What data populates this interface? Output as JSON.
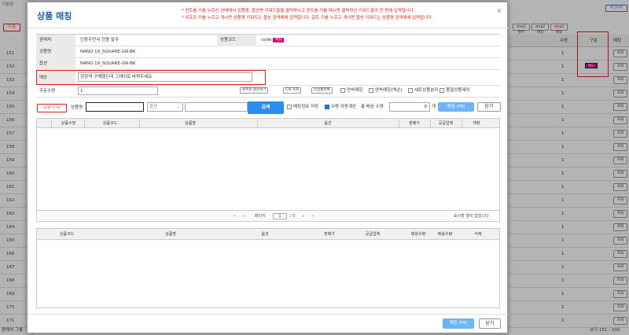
{
  "background": {
    "left_rows": [
      "151",
      "152",
      "153",
      "154",
      "155",
      "156",
      "157",
      "158",
      "159",
      "160",
      "161",
      "162",
      "163",
      "164",
      "165",
      "166",
      "167",
      "168",
      "169",
      "170",
      "171"
    ],
    "right_top_buttons": [
      "step1 발주",
      "step2 메일",
      "step3 메일"
    ],
    "right_logout": "로그아웃",
    "right_headers": [
      "수량",
      "구분",
      "매칭"
    ],
    "right_qty": "1",
    "right_gubun_badge": "메모",
    "right_match_btn": "조회",
    "left_top_label": "기본정",
    "left_del_btn": "다 을",
    "bottom_left": "판매처 그룹",
    "bottom_right": "보기 151 - 200"
  },
  "modal": {
    "title": "상품 매칭",
    "notice": [
      "* 컨트롤 키를 누르신 상태에서 상품명, 옵션명 키워드들을 클릭하시고 컨트롤 키를 떼시면 클릭하신 키워드들이 한 번에 입력됩니다.",
      "* 쉬프트 키를 누르고 게시면 상품명 키워드는 옵션 검색에에 입력됩니다. 알트 키를 누르고 게시면 옵션 키워드는 상품명 검색에에 입력됩니다."
    ],
    "close": "✕",
    "info": {
      "seller_label": "판매처",
      "seller_value": "인동우먼서 전용 발주",
      "code_label": "상품코드",
      "code_value": "code",
      "code_badge": "매칭",
      "product_label": "상품명",
      "product_value": "NANO 19_SQUARE-GN-BK",
      "option_label": "옵션",
      "option_value": "NANO 19_SQUARE-GN-BK",
      "memo_label": "메모",
      "memo_value": "검정색 구매했는데 그레이로 바꿔주세요",
      "order_qty_label": "주문수량",
      "order_qty_value": "1"
    },
    "tools": {
      "btn1": "원주문 옵션보기",
      "btn2": "C/S 조회",
      "btn3": "신상품등록",
      "chk1": "연속매칭",
      "chk2": "연속매칭(엑손)",
      "chk3": "세트상품분리",
      "chk4": "품절상품제외"
    },
    "search": {
      "ctrl_label": "(Ctrl + x)",
      "product_label": "상품명",
      "product_value": "",
      "option_placeholder": "옵션",
      "search_button": "검색",
      "chk_save": "매칭정보 저장",
      "chk_auto": "수량 자동계산",
      "total_label": "총 배송 수량",
      "total_value": "0",
      "unit": "개",
      "match_button": "매칭 (F9)",
      "close_button": "닫기"
    },
    "grid1": {
      "headers": [
        "상품수정",
        "상품코드",
        "상품명",
        "옵션",
        "판매가",
        "공급업체",
        "재정"
      ],
      "pager": {
        "page_label": "페이지",
        "page_value": "1",
        "total": "/ 0",
        "empty": "표시할 행이 없습니다"
      }
    },
    "grid2": {
      "headers": [
        "상품코드",
        "상품명",
        "옵션",
        "판매가",
        "공급업체",
        "매칭수량",
        "배송수량",
        "삭제"
      ]
    },
    "footer": {
      "match_button": "매칭 (F9)",
      "close_button": "닫기"
    }
  }
}
